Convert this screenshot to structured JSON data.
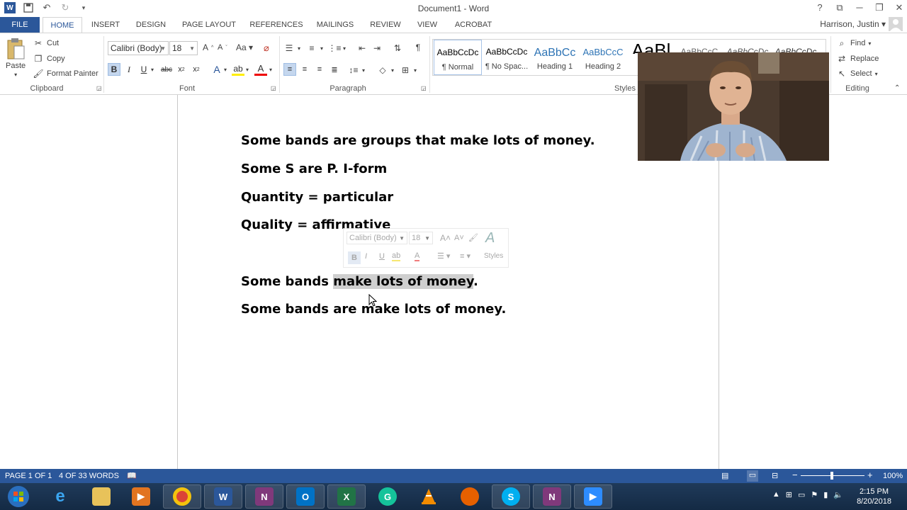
{
  "titlebar": {
    "title": "Document1 - Word",
    "help": "?",
    "restore_ribbon": "⧉",
    "minimize": "─",
    "maximize": "❐",
    "close": "✕"
  },
  "tabs": {
    "file": "FILE",
    "items": [
      "HOME",
      "INSERT",
      "DESIGN",
      "PAGE LAYOUT",
      "REFERENCES",
      "MAILINGS",
      "REVIEW",
      "VIEW",
      "ACROBAT"
    ],
    "active": "HOME"
  },
  "user": {
    "name": "Harrison, Justin"
  },
  "clipboard": {
    "paste": "Paste",
    "cut": "Cut",
    "copy": "Copy",
    "format_painter": "Format Painter",
    "label": "Clipboard"
  },
  "font": {
    "name": "Calibri (Body)",
    "size": "18",
    "label": "Font"
  },
  "paragraph": {
    "label": "Paragraph"
  },
  "styles": {
    "label": "Styles",
    "items": [
      {
        "preview": "AaBbCcDc",
        "name": "¶ Normal"
      },
      {
        "preview": "AaBbCcDc",
        "name": "¶ No Spac..."
      },
      {
        "preview": "AaBbCc",
        "name": "Heading 1"
      },
      {
        "preview": "AaBbCcC",
        "name": "Heading 2"
      },
      {
        "preview": "AaBl",
        "name": ""
      },
      {
        "preview": "AaBbCcC",
        "name": ""
      },
      {
        "preview": "AaBbCcDc",
        "name": ""
      },
      {
        "preview": "AaBbCcDc",
        "name": ""
      }
    ]
  },
  "editing": {
    "find": "Find",
    "replace": "Replace",
    "select": "Select",
    "label": "Editing"
  },
  "document": {
    "lines": [
      "Some bands are groups that make lots of money.",
      "Some S are P. I-form",
      "Quantity = particular",
      "Quality = affirmative"
    ],
    "line5_prefix": "Some bands ",
    "line5_highlight": "make lots of money",
    "line5_suffix": ".",
    "line6": "Some bands are make lots of money."
  },
  "mini_toolbar": {
    "font": "Calibri (Body)",
    "size": "18",
    "styles": "Styles"
  },
  "statusbar": {
    "page": "PAGE 1 OF 1",
    "words": "4 OF 33 WORDS",
    "zoom": "100%"
  },
  "clock": {
    "time": "2:15 PM",
    "date": "8/20/2018"
  },
  "colors": {
    "word_blue": "#2b579a",
    "selection": "#cfcfcf",
    "taskbar": "#1f3a5a"
  }
}
